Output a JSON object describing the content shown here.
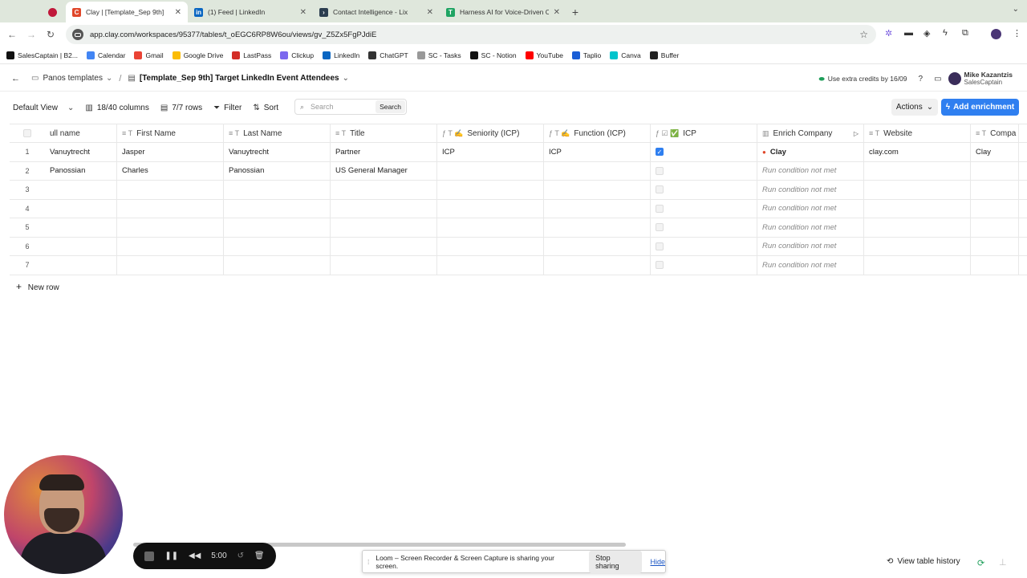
{
  "browser": {
    "tabs": [
      {
        "title": "",
        "favicon_color": "#c0183a",
        "active": false
      },
      {
        "title": "Clay | [Template_Sep 9th]",
        "favicon_color": "#e0472a",
        "active": true
      },
      {
        "title": "(1) Feed | LinkedIn",
        "favicon_color": "#0a66c2",
        "active": false
      },
      {
        "title": "Contact Intelligence - Lix",
        "favicon_color": "#2c3e50",
        "active": false
      },
      {
        "title": "Harness AI for Voice-Driven C",
        "favicon_color": "#1fa463",
        "active": false
      }
    ],
    "url": "app.clay.com/workspaces/95377/tables/t_oEGC6RP8W6ou/views/gv_Z5Zx5FgPJdiE",
    "bookmarks": [
      {
        "label": "SalesCaptain | B2...",
        "color": "#111"
      },
      {
        "label": "Calendar",
        "color": "#4285f4"
      },
      {
        "label": "Gmail",
        "color": "#ea4335"
      },
      {
        "label": "Google Drive",
        "color": "#fbbc04"
      },
      {
        "label": "LastPass",
        "color": "#d32d27"
      },
      {
        "label": "Clickup",
        "color": "#7b68ee"
      },
      {
        "label": "LinkedIn",
        "color": "#0a66c2"
      },
      {
        "label": "ChatGPT",
        "color": "#333"
      },
      {
        "label": "SC - Tasks",
        "color": "#999"
      },
      {
        "label": "SC - Notion",
        "color": "#111"
      },
      {
        "label": "YouTube",
        "color": "#ff0000"
      },
      {
        "label": "Taplio",
        "color": "#1a5ed6"
      },
      {
        "label": "Canva",
        "color": "#00c4cc"
      },
      {
        "label": "Buffer",
        "color": "#222"
      }
    ]
  },
  "header": {
    "workspace": "Panos templates",
    "table_title": "[Template_Sep 9th] Target LinkedIn Event Attendees",
    "credits": "Use extra credits by 16/09",
    "user_name": "Mike Kazantzis",
    "user_org": "SalesCaptain"
  },
  "toolbar": {
    "view": "Default View",
    "columns": "18/40 columns",
    "rows": "7/7 rows",
    "filter": "Filter",
    "sort": "Sort",
    "search_placeholder": "Search",
    "search_button": "Search",
    "actions": "Actions",
    "add_enrichment": "Add enrichment"
  },
  "table": {
    "columns": [
      "ull name",
      "First Name",
      "Last Name",
      "Title",
      "Seniority (ICP)",
      "Function (ICP)",
      "ICP",
      "Enrich Company",
      "Website",
      "Compa"
    ],
    "rows": [
      {
        "n": "1",
        "cells": [
          "Vanuytrecht",
          "Jasper",
          "Vanuytrecht",
          "Partner",
          "ICP",
          "ICP",
          "",
          "Clay",
          "clay.com",
          "Clay"
        ]
      },
      {
        "n": "2",
        "cells": [
          "Panossian",
          "Charles",
          "Panossian",
          "US General Manager",
          "",
          "",
          "",
          "Run condition not met",
          "",
          ""
        ]
      },
      {
        "n": "3",
        "cells": [
          "",
          "",
          "",
          "",
          "",
          "",
          "",
          "Run condition not met",
          "",
          ""
        ]
      },
      {
        "n": "4",
        "cells": [
          "",
          "",
          "",
          "",
          "",
          "",
          "",
          "Run condition not met",
          "",
          ""
        ]
      },
      {
        "n": "5",
        "cells": [
          "",
          "",
          "",
          "",
          "",
          "",
          "",
          "Run condition not met",
          "",
          ""
        ]
      },
      {
        "n": "6",
        "cells": [
          "",
          "",
          "",
          "",
          "",
          "",
          "",
          "Run condition not met",
          "",
          ""
        ]
      },
      {
        "n": "7",
        "cells": [
          "",
          "",
          "",
          "",
          "",
          "",
          "",
          "Run condition not met",
          "",
          ""
        ]
      }
    ],
    "icp_checked": [
      true,
      false,
      false,
      false,
      false,
      false,
      false
    ],
    "new_row": "New row"
  },
  "loom": {
    "timer": "5:00",
    "share_text": "Loom – Screen Recorder & Screen Capture is sharing your screen.",
    "stop": "Stop sharing",
    "hide": "Hide"
  },
  "footer": {
    "history": "View table history"
  }
}
